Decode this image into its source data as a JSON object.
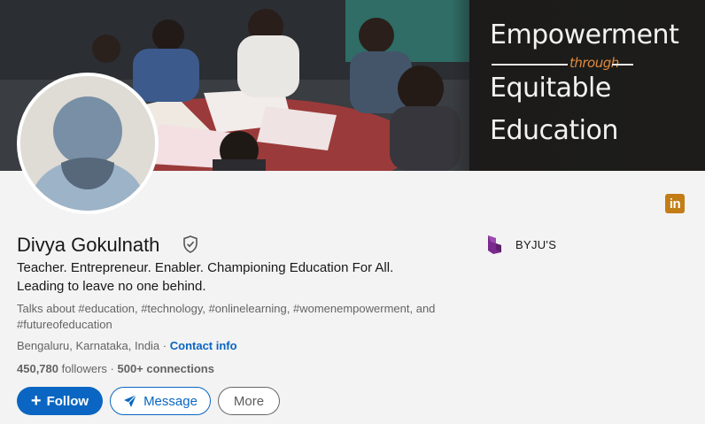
{
  "banner": {
    "line1": "Empowerment",
    "through": "through",
    "line2": "Equitable",
    "line3": "Education"
  },
  "profile": {
    "name": "Divya Gokulnath",
    "headline_line1": "Teacher. Entrepreneur. Enabler. Championing Education For All.",
    "headline_line2": "Leading to leave no one behind.",
    "talks_about": "Talks about #education, #technology, #onlinelearning, #womenempowerment, and #futureofeducation",
    "location": "Bengaluru, Karnataka, India",
    "separator": " · ",
    "contact_info": "Contact info",
    "followers_count": "450,780",
    "followers_label": " followers",
    "connections": "500+ connections"
  },
  "company": {
    "name": "BYJU'S"
  },
  "badge": {
    "label": "in"
  },
  "actions": {
    "follow": "Follow",
    "message": "Message",
    "more": "More"
  },
  "colors": {
    "primary": "#0a66c2",
    "badge": "#c37d16",
    "byjus_purple": "#7a2a8c"
  }
}
